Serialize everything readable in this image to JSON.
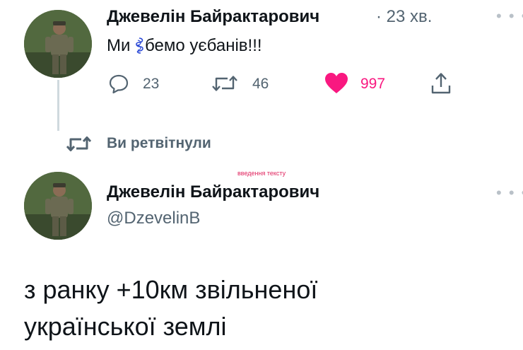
{
  "tweet": {
    "author_name": "Джевелін Байрактарович",
    "time": "· 23 хв.",
    "text_before": "Ми ",
    "text_after": "бемо уєбанів!!!",
    "more": "• • •",
    "actions": {
      "replies": "23",
      "retweets": "46",
      "likes": "997"
    },
    "colors": {
      "like": "#f91880",
      "muted": "#536471"
    }
  },
  "retweet_banner": {
    "label": "Ви ретвітнули"
  },
  "annotation": {
    "text": "введення тексту"
  },
  "retweeted_tweet": {
    "author_name": "Джевелін Байрактарович",
    "handle": "@DzevelinB",
    "more": "• • •",
    "text_line_1": "з ранку +10км звільненої",
    "text_line_2": "української землі"
  }
}
